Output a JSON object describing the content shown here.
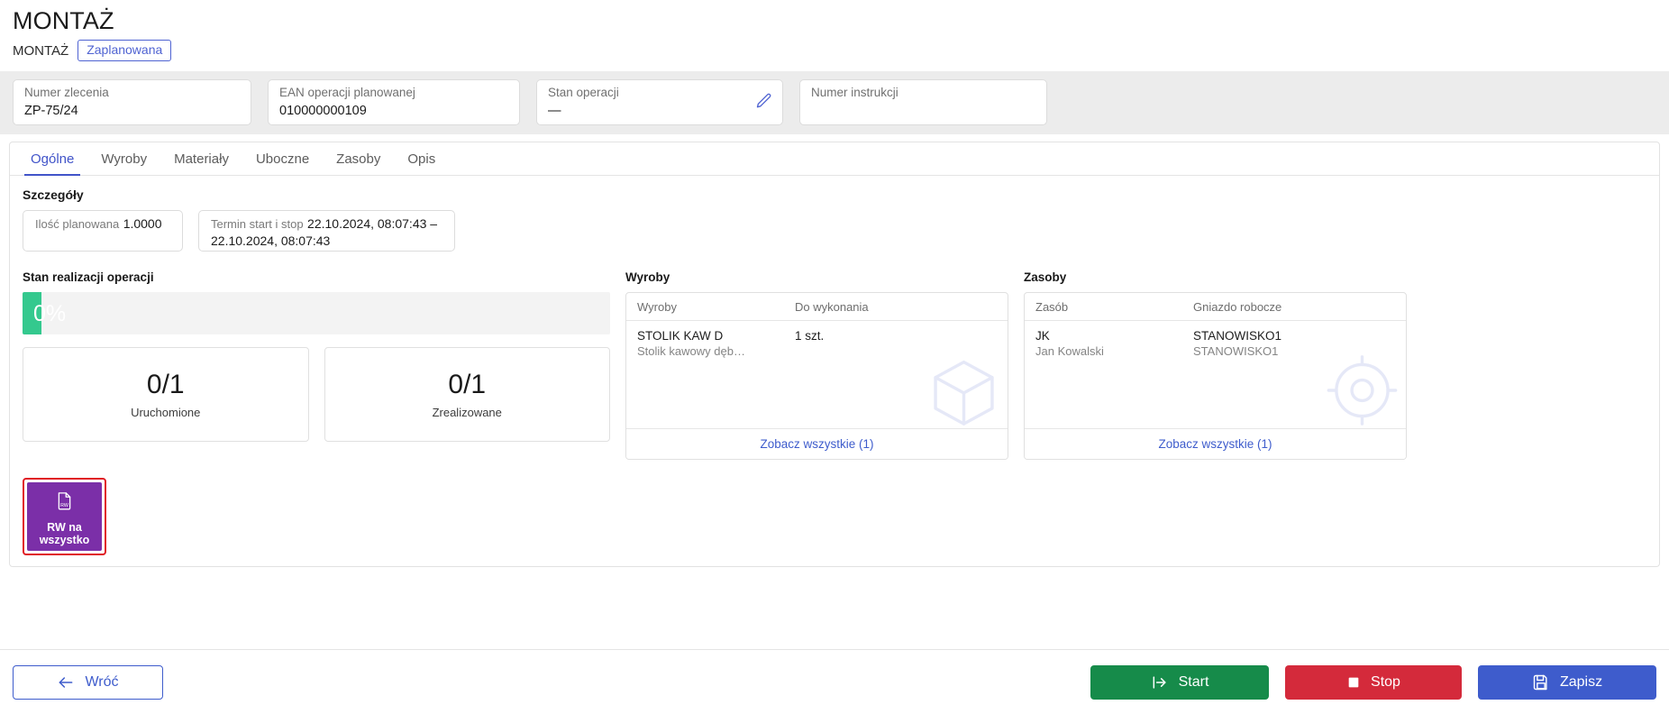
{
  "header": {
    "title": "MONTAŻ",
    "breadcrumb": "MONTAŻ",
    "status_badge": "Zaplanowana",
    "badge_color": "#4f63d2"
  },
  "info_cards": [
    {
      "label": "Numer zlecenia",
      "value": "ZP-75/24"
    },
    {
      "label": "EAN operacji planowanej",
      "value": "010000000109"
    },
    {
      "label": "Stan operacji",
      "value": "—",
      "icon": "pencil-icon"
    },
    {
      "label": "Numer instrukcji",
      "value": ""
    }
  ],
  "tabs": [
    {
      "label": "Ogólne",
      "active": true
    },
    {
      "label": "Wyroby",
      "active": false
    },
    {
      "label": "Materiały",
      "active": false
    },
    {
      "label": "Uboczne",
      "active": false
    },
    {
      "label": "Zasoby",
      "active": false
    },
    {
      "label": "Opis",
      "active": false
    }
  ],
  "details": {
    "section_title": "Szczegóły",
    "fields": [
      {
        "label": "Ilość planowana",
        "value": "1.0000"
      },
      {
        "label": "Termin start i stop",
        "value": "22.10.2024, 08:07:43 – 22.10.2024, 08:07:43"
      }
    ]
  },
  "progress": {
    "heading": "Stan realizacji operacji",
    "percent_label": "0%",
    "percent": 0,
    "fill_color": "#34c98e",
    "track_color": "#f3f3f3"
  },
  "stats": [
    {
      "value": "0/1",
      "label": "Uruchomione"
    },
    {
      "value": "0/1",
      "label": "Zrealizowane"
    }
  ],
  "products_panel": {
    "heading": "Wyroby",
    "columns": [
      "Wyroby",
      "Do wykonania"
    ],
    "rows": [
      {
        "code": "STOLIK KAW D",
        "description": "Stolik kawowy dęb…",
        "quantity": "1 szt."
      }
    ],
    "footer_link": "Zobacz wszystkie (1)",
    "watermark_icon": "package-watermark-icon"
  },
  "resources_panel": {
    "heading": "Zasoby",
    "columns": [
      "Zasób",
      "Gniazdo robocze"
    ],
    "rows": [
      {
        "code": "JK",
        "description": "Jan Kowalski",
        "workstation": "STANOWISKO1",
        "workstation_sub": "STANOWISKO1"
      }
    ],
    "footer_link": "Zobacz wszystkie (1)",
    "watermark_icon": "gear-watermark-icon"
  },
  "rw_button": {
    "line1": "RW na",
    "line2": "wszystko",
    "icon": "document-rw-icon",
    "background": "#7b2fa8",
    "focus_ring": "#e01b24"
  },
  "footer": {
    "back": {
      "label": "Wróć",
      "icon": "arrow-left-icon",
      "color": "#3e5ccc"
    },
    "start": {
      "label": "Start",
      "icon": "start-arrow-icon",
      "color": "#168b4a"
    },
    "stop": {
      "label": "Stop",
      "icon": "stop-square-icon",
      "color": "#d42a3b"
    },
    "save": {
      "label": "Zapisz",
      "icon": "floppy-disk-icon",
      "color": "#3e5ccc"
    }
  }
}
